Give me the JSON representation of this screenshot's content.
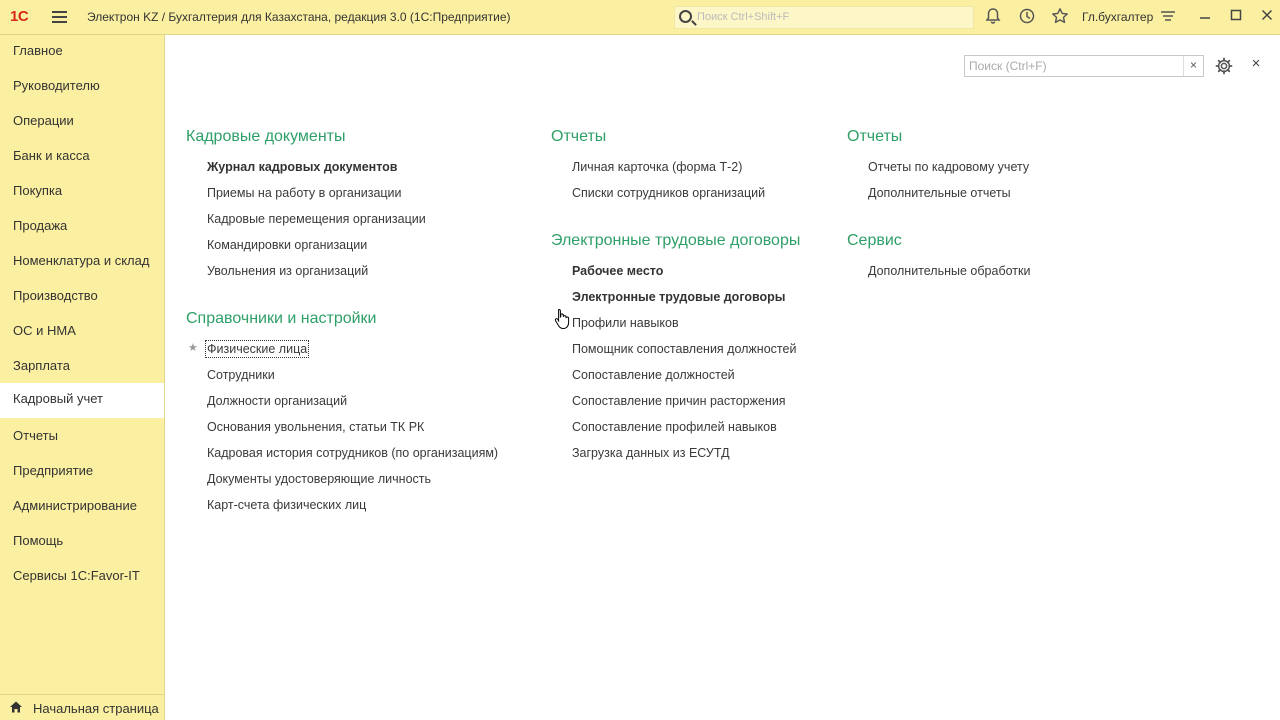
{
  "titlebar": {
    "logo": "1С",
    "app_title": "Электрон KZ / Бухгалтерия для Казахстана, редакция 3.0  (1С:Предприятие)",
    "search_placeholder": "Поиск Ctrl+Shift+F",
    "user": "Гл.бухгалтер",
    "icons": [
      "bell-icon",
      "history-icon",
      "star-icon",
      "settings-lines-icon"
    ],
    "window_buttons": [
      "minimize",
      "maximize",
      "close"
    ]
  },
  "sidebar": {
    "items": [
      {
        "label": "Главное"
      },
      {
        "label": "Руководителю"
      },
      {
        "label": "Операции"
      },
      {
        "label": "Банк и касса"
      },
      {
        "label": "Покупка"
      },
      {
        "label": "Продажа"
      },
      {
        "label": "Номенклатура и склад"
      },
      {
        "label": "Производство"
      },
      {
        "label": "ОС и НМА"
      },
      {
        "label": "Зарплата"
      },
      {
        "label": "Кадровый учет"
      },
      {
        "label": "Отчеты"
      },
      {
        "label": "Предприятие"
      },
      {
        "label": "Администрирование"
      },
      {
        "label": "Помощь"
      },
      {
        "label": "Сервисы 1С:Favor-IT"
      }
    ],
    "active_item": "Кадровый учет",
    "home_label": "Начальная страница"
  },
  "content": {
    "search_placeholder": "Поиск (Ctrl+F)",
    "search_clear": "×",
    "col1": {
      "section1": {
        "title": "Кадровые документы",
        "links": [
          "Журнал кадровых документов",
          "Приемы на работу в организации",
          "Кадровые перемещения организации",
          "Командировки организации",
          "Увольнения из организаций"
        ]
      },
      "section2": {
        "title": "Справочники и настройки",
        "links": [
          "Физические лица",
          "Сотрудники",
          "Должности организаций",
          "Основания увольнения, статьи ТК РК",
          "Кадровая история сотрудников (по организациям)",
          "Документы удостоверяющие личность",
          "Карт-счета физических лиц"
        ]
      }
    },
    "col2": {
      "section1": {
        "title": "Отчеты",
        "links": [
          "Личная карточка (форма Т-2)",
          "Списки сотрудников организаций"
        ]
      },
      "section2": {
        "title": "Электронные трудовые договоры",
        "links": [
          "Рабочее место",
          "Электронные трудовые договоры",
          "Профили навыков",
          "Помощник сопоставления должностей",
          "Сопоставление должностей",
          "Сопоставление причин расторжения",
          "Сопоставление профилей навыков",
          "Загрузка данных из ЕСУТД"
        ]
      }
    },
    "col3": {
      "section1": {
        "title": "Отчеты",
        "links": [
          "Отчеты по кадровому учету",
          "Дополнительные отчеты"
        ]
      },
      "section2": {
        "title": "Сервис",
        "links": [
          "Дополнительные обработки"
        ]
      }
    }
  }
}
